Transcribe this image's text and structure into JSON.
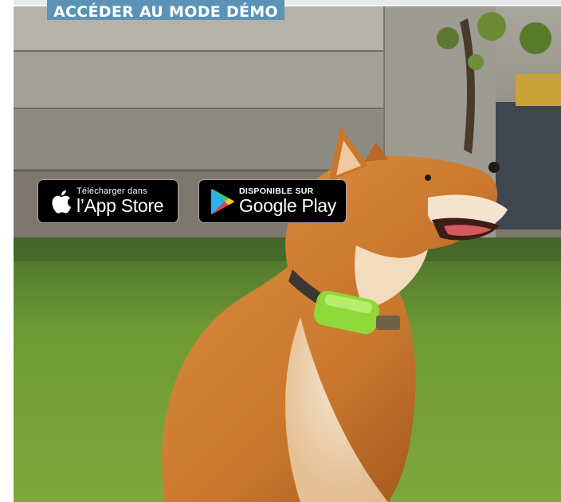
{
  "demo_button": {
    "label": "ACCÉDER AU MODE DÉMO",
    "color": "#5b93b6"
  },
  "app_store_badge": {
    "top_line": "Télécharger dans",
    "bottom_line": "l’App Store"
  },
  "google_play_badge": {
    "top_line": "DISPONIBLE SUR",
    "bottom_line": "Google Play"
  },
  "hero_image": {
    "subject": "dog-with-gps-collar-photo"
  }
}
